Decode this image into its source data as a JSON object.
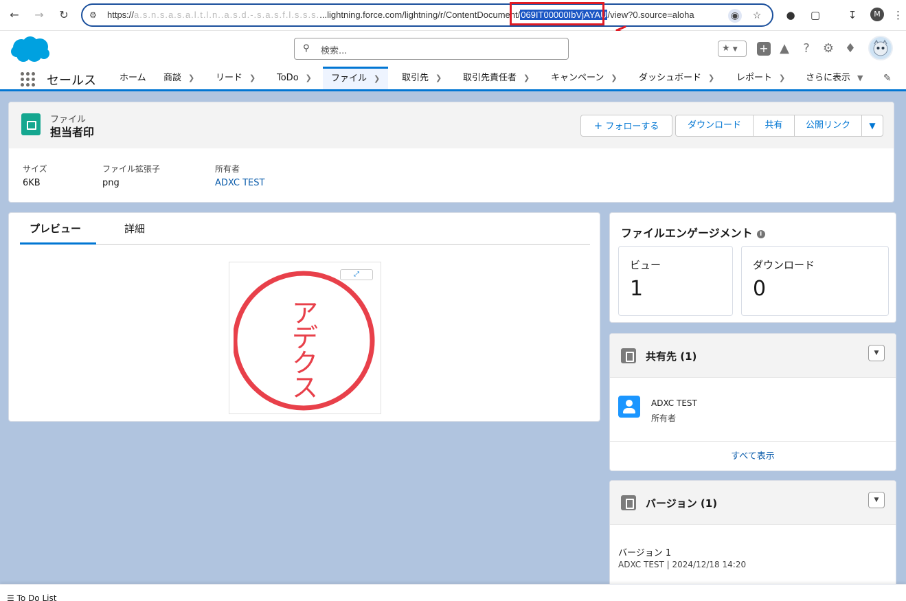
{
  "browser": {
    "url_prefix": "https://",
    "url_blurred": "a.s.n.s.a.s.a.l.t.l.n..a.s.d.-.s.a.s.f.l.s.s.s.",
    "url_domain": "...lightning.force.com/lightning/r/ContentDocument/",
    "url_highlight": "069IT00000IbVjAYAU",
    "url_suffix": "/view?0.source=aloha",
    "profile_initial": "M"
  },
  "header": {
    "search_placeholder": "検索..."
  },
  "nav": {
    "app_name": "セールス",
    "items": [
      {
        "label": "ホーム"
      },
      {
        "label": "商談"
      },
      {
        "label": "リード"
      },
      {
        "label": "ToDo"
      },
      {
        "label": "ファイル"
      },
      {
        "label": "取引先"
      },
      {
        "label": "取引先責任者"
      },
      {
        "label": "キャンペーン"
      },
      {
        "label": "ダッシュボード"
      },
      {
        "label": "レポート"
      },
      {
        "label": "さらに表示"
      }
    ]
  },
  "record": {
    "type": "ファイル",
    "title": "担当者印",
    "buttons": {
      "follow": "フォローする",
      "download": "ダウンロード",
      "share": "共有",
      "public_link": "公開リンク"
    },
    "fields": [
      {
        "label": "サイズ",
        "value": "6KB"
      },
      {
        "label": "ファイル拡張子",
        "value": "png"
      },
      {
        "label": "所有者",
        "value": "ADXC TEST"
      }
    ]
  },
  "preview": {
    "tabs": [
      "プレビュー",
      "詳細"
    ],
    "stamp_text": "アデクス"
  },
  "engagement": {
    "title": "ファイルエンゲージメント",
    "stats": [
      {
        "label": "ビュー",
        "value": "1"
      },
      {
        "label": "ダウンロード",
        "value": "0"
      }
    ]
  },
  "shared": {
    "title": "共有先 (1)",
    "user_name": "ADXC TEST",
    "user_role": "所有者",
    "footer": "すべて表示"
  },
  "versions": {
    "title": "バージョン (1)",
    "name": "バージョン 1",
    "meta": "ADXC TEST | 2024/12/18 14:20"
  },
  "utility": {
    "todo_label": "To Do List"
  },
  "colors": {
    "brand_blue": "#0176d3",
    "link": "#0b5cab",
    "backdrop": "#b0c4df",
    "file_icon": "#15a790",
    "stamp_red": "#e8404a",
    "annotation_red": "#e01b24"
  }
}
